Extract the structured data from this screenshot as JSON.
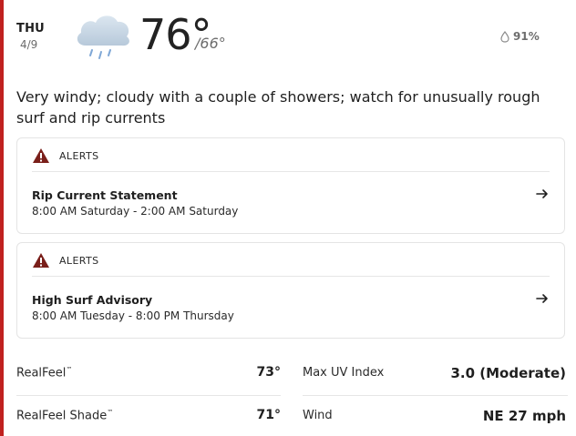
{
  "colors": {
    "accent": "#c0211f",
    "alert_triangle": "#7a1f1a",
    "text_muted": "#6e6e6e"
  },
  "forecast": {
    "day": "THU",
    "date": "4/9",
    "high": "76°",
    "low": "/66°",
    "precip": "91%",
    "precip_icon": "droplet-icon",
    "weather_icon": "cloud-showers-icon",
    "phrase": "Very windy; cloudy with a couple of showers; watch for unusually rough surf and rip currents"
  },
  "alerts": [
    {
      "label": "ALERTS",
      "title": "Rip Current Statement",
      "time": "8:00 AM Saturday - 2:00 AM Saturday",
      "icon": "warning-triangle-icon"
    },
    {
      "label": "ALERTS",
      "title": "High Surf Advisory",
      "time": "8:00 AM Tuesday - 8:00 PM Thursday",
      "icon": "warning-triangle-icon"
    }
  ],
  "details": {
    "realfeel_label": "RealFeel",
    "realfeel_value": "73°",
    "realfeel_shade_label": "RealFeel Shade",
    "realfeel_shade_value": "71°",
    "uv_label": "Max UV Index",
    "uv_value": "3.0 (Moderate)",
    "wind_label": "Wind",
    "wind_value": "NE 27 mph",
    "trademark": "™"
  }
}
